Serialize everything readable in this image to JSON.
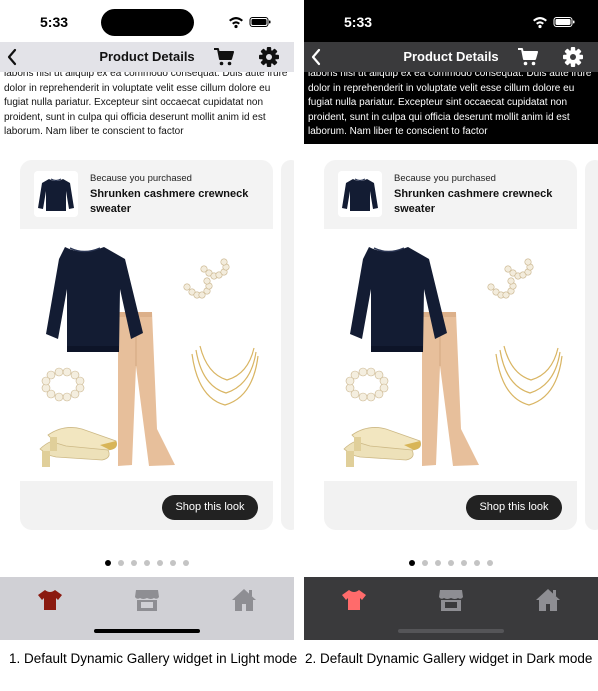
{
  "phones": [
    {
      "mode": "light",
      "status_time": "5:33",
      "nav_title": "Product Details",
      "description": "laboris nisi ut aliquip ex ea commodo consequat. Duis aute irure dolor in reprehenderit in voluptate velit esse cillum dolore eu fugiat nulla pariatur. Excepteur sint occaecat cupidatat non proident, sunt in culpa qui officia deserunt mollit anim id est laborum. Nam liber te conscient to factor",
      "card": {
        "because_text": "Because you purchased",
        "product_name": "Shrunken cashmere crewneck sweater",
        "button_label": "Shop this look"
      },
      "pager": {
        "count": 7,
        "active_index": 0
      },
      "tabs": [
        "shirt-icon",
        "store-icon",
        "home-icon"
      ],
      "active_tab_color": "#8b1a10",
      "inactive_tab_color": "#8e8e93",
      "caption": "1. Default Dynamic Gallery widget in Light mode"
    },
    {
      "mode": "dark",
      "status_time": "5:33",
      "nav_title": "Product Details",
      "description": "laboris nisi ut aliquip ex ea commodo consequat. Duis aute irure dolor in reprehenderit in voluptate velit esse cillum dolore eu fugiat nulla pariatur. Excepteur sint occaecat cupidatat non proident, sunt in culpa qui officia deserunt mollit anim id est laborum. Nam liber te conscient to factor",
      "card": {
        "because_text": "Because you purchased",
        "product_name": "Shrunken cashmere crewneck sweater",
        "button_label": "Shop this look"
      },
      "pager": {
        "count": 7,
        "active_index": 0
      },
      "tabs": [
        "shirt-icon",
        "store-icon",
        "home-icon"
      ],
      "active_tab_color": "#ff6b6b",
      "inactive_tab_color": "#8e8e93",
      "caption": "2. Default Dynamic Gallery widget in Dark mode"
    }
  ]
}
